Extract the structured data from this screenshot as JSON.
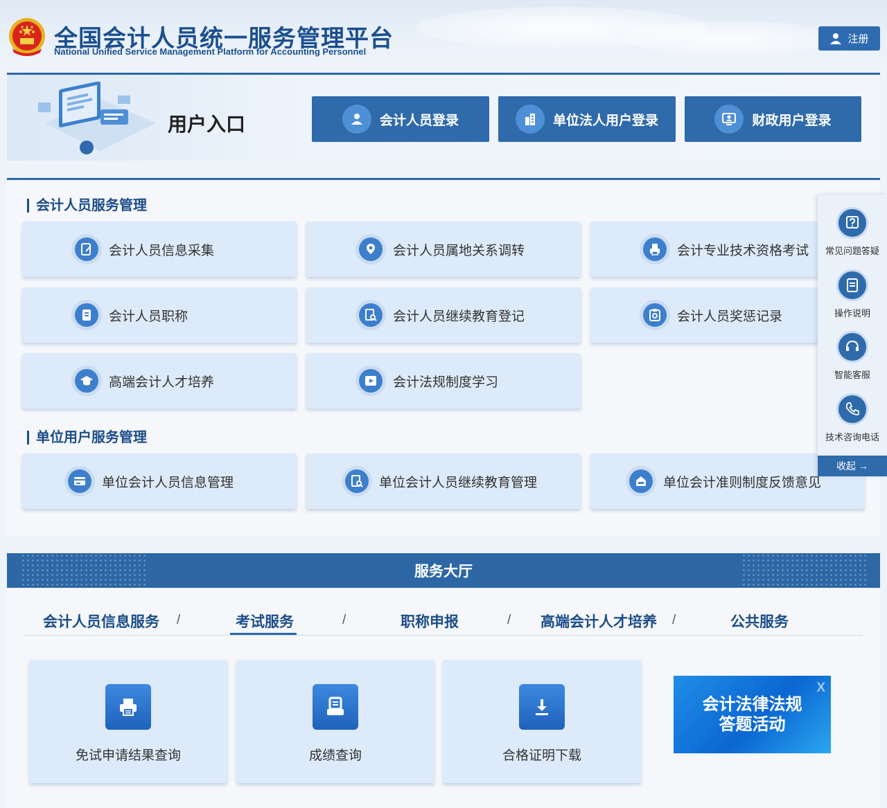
{
  "header": {
    "title": "全国会计人员统一服务管理平台",
    "subtitle": "National Unified Service Management Platform for Accounting Personnel",
    "register_label": "注册"
  },
  "entry": {
    "title": "用户入口",
    "buttons": [
      {
        "label": "会计人员登录",
        "icon": "user-icon"
      },
      {
        "label": "单位法人用户登录",
        "icon": "building-icon"
      },
      {
        "label": "财政用户登录",
        "icon": "monitor-user-icon"
      }
    ]
  },
  "accounting_section": {
    "title": "会计人员服务管理",
    "cards": [
      {
        "label": "会计人员信息采集",
        "icon": "edit-form-icon"
      },
      {
        "label": "会计人员属地关系调转",
        "icon": "location-icon"
      },
      {
        "label": "会计专业技术资格考试",
        "icon": "printer-icon"
      },
      {
        "label": "会计人员职称",
        "icon": "document-icon"
      },
      {
        "label": "会计人员继续教育登记",
        "icon": "search-doc-icon"
      },
      {
        "label": "会计人员奖惩记录",
        "icon": "clipboard-search-icon"
      },
      {
        "label": "高端会计人才培养",
        "icon": "graduation-cap-icon"
      },
      {
        "label": "会计法规制度学习",
        "icon": "play-icon"
      }
    ]
  },
  "unit_section": {
    "title": "单位用户服务管理",
    "cards": [
      {
        "label": "单位会计人员信息管理",
        "icon": "card-icon"
      },
      {
        "label": "单位会计人员继续教育管理",
        "icon": "search-doc-icon"
      },
      {
        "label": "单位会计准则制度反馈意见",
        "icon": "mailbox-icon"
      }
    ]
  },
  "hall": {
    "title": "服务大厅",
    "tabs": [
      "会计人员信息服务",
      "考试服务",
      "职称申报",
      "高端会计人才培养",
      "公共服务"
    ],
    "separator": "/",
    "active_tab": "考试服务",
    "cards": [
      {
        "label": "免试申请结果查询",
        "icon": "printer-icon"
      },
      {
        "label": "成绩查询",
        "icon": "score-doc-icon"
      },
      {
        "label": "合格证明下载",
        "icon": "download-icon"
      }
    ],
    "promo": {
      "line1": "会计法律法规",
      "line2": "答题活动",
      "close": "X"
    }
  },
  "sidebar": {
    "items": [
      {
        "label": "常见问题答疑",
        "icon": "question-icon"
      },
      {
        "label": "操作说明",
        "icon": "manual-icon"
      },
      {
        "label": "智能客服",
        "icon": "headset-icon"
      },
      {
        "label": "技术咨询电话",
        "icon": "phone-icon"
      }
    ],
    "collapse_label": "收起 →"
  },
  "colors": {
    "primary": "#2f6aab",
    "title_blue": "#1b4f8f",
    "card_bg": "#ddeaf9"
  }
}
